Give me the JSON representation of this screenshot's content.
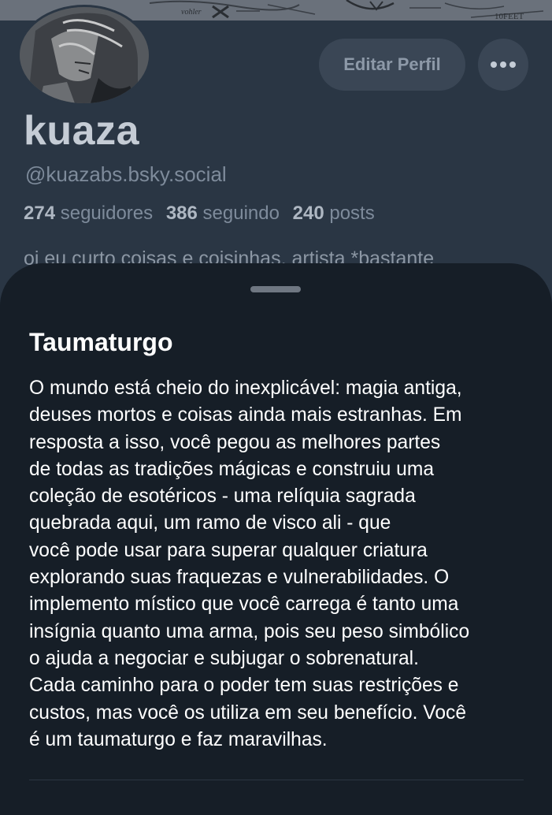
{
  "profile": {
    "display_name": "kuaza",
    "handle": "@kuazabs.bsky.social",
    "followers_count": "274",
    "followers_label": "seguidores",
    "following_count": "386",
    "following_label": "seguindo",
    "posts_count": "240",
    "posts_label": "posts",
    "bio_preview": "oi eu curto coisas e coisinhas, artista *bastante",
    "edit_button_label": "Editar Perfil",
    "more_icon": "ellipsis-icon"
  },
  "banner": {
    "sketch_texts": [
      "vohler",
      "10FEET"
    ]
  },
  "sheet": {
    "title": "Taumaturgo",
    "body_lines": [
      "O mundo está cheio do inexplicável: magia antiga,",
      "deuses mortos e coisas ainda mais estranhas. Em",
      "resposta a isso, você pegou as melhores partes",
      "de todas as tradições mágicas e construiu uma",
      "coleção de esotéricos - uma relíquia sagrada",
      "quebrada aqui, um ramo de visco ali - que",
      "você pode usar para superar qualquer criatura",
      "explorando suas fraquezas e vulnerabilidades. O",
      "implemento místico que você carrega é tanto uma",
      "insígnia quanto uma arma, pois seu peso simbólico",
      "o ajuda a negociar e subjugar o sobrenatural.",
      "Cada caminho para o poder tem suas restrições e",
      "custos, mas você os utiliza em seu benefício. Você",
      "é um taumaturgo e faz maravilhas."
    ]
  },
  "colors": {
    "profile_bg": "#2a3644",
    "sheet_bg": "#161e27",
    "button_bg": "#3a4655"
  }
}
